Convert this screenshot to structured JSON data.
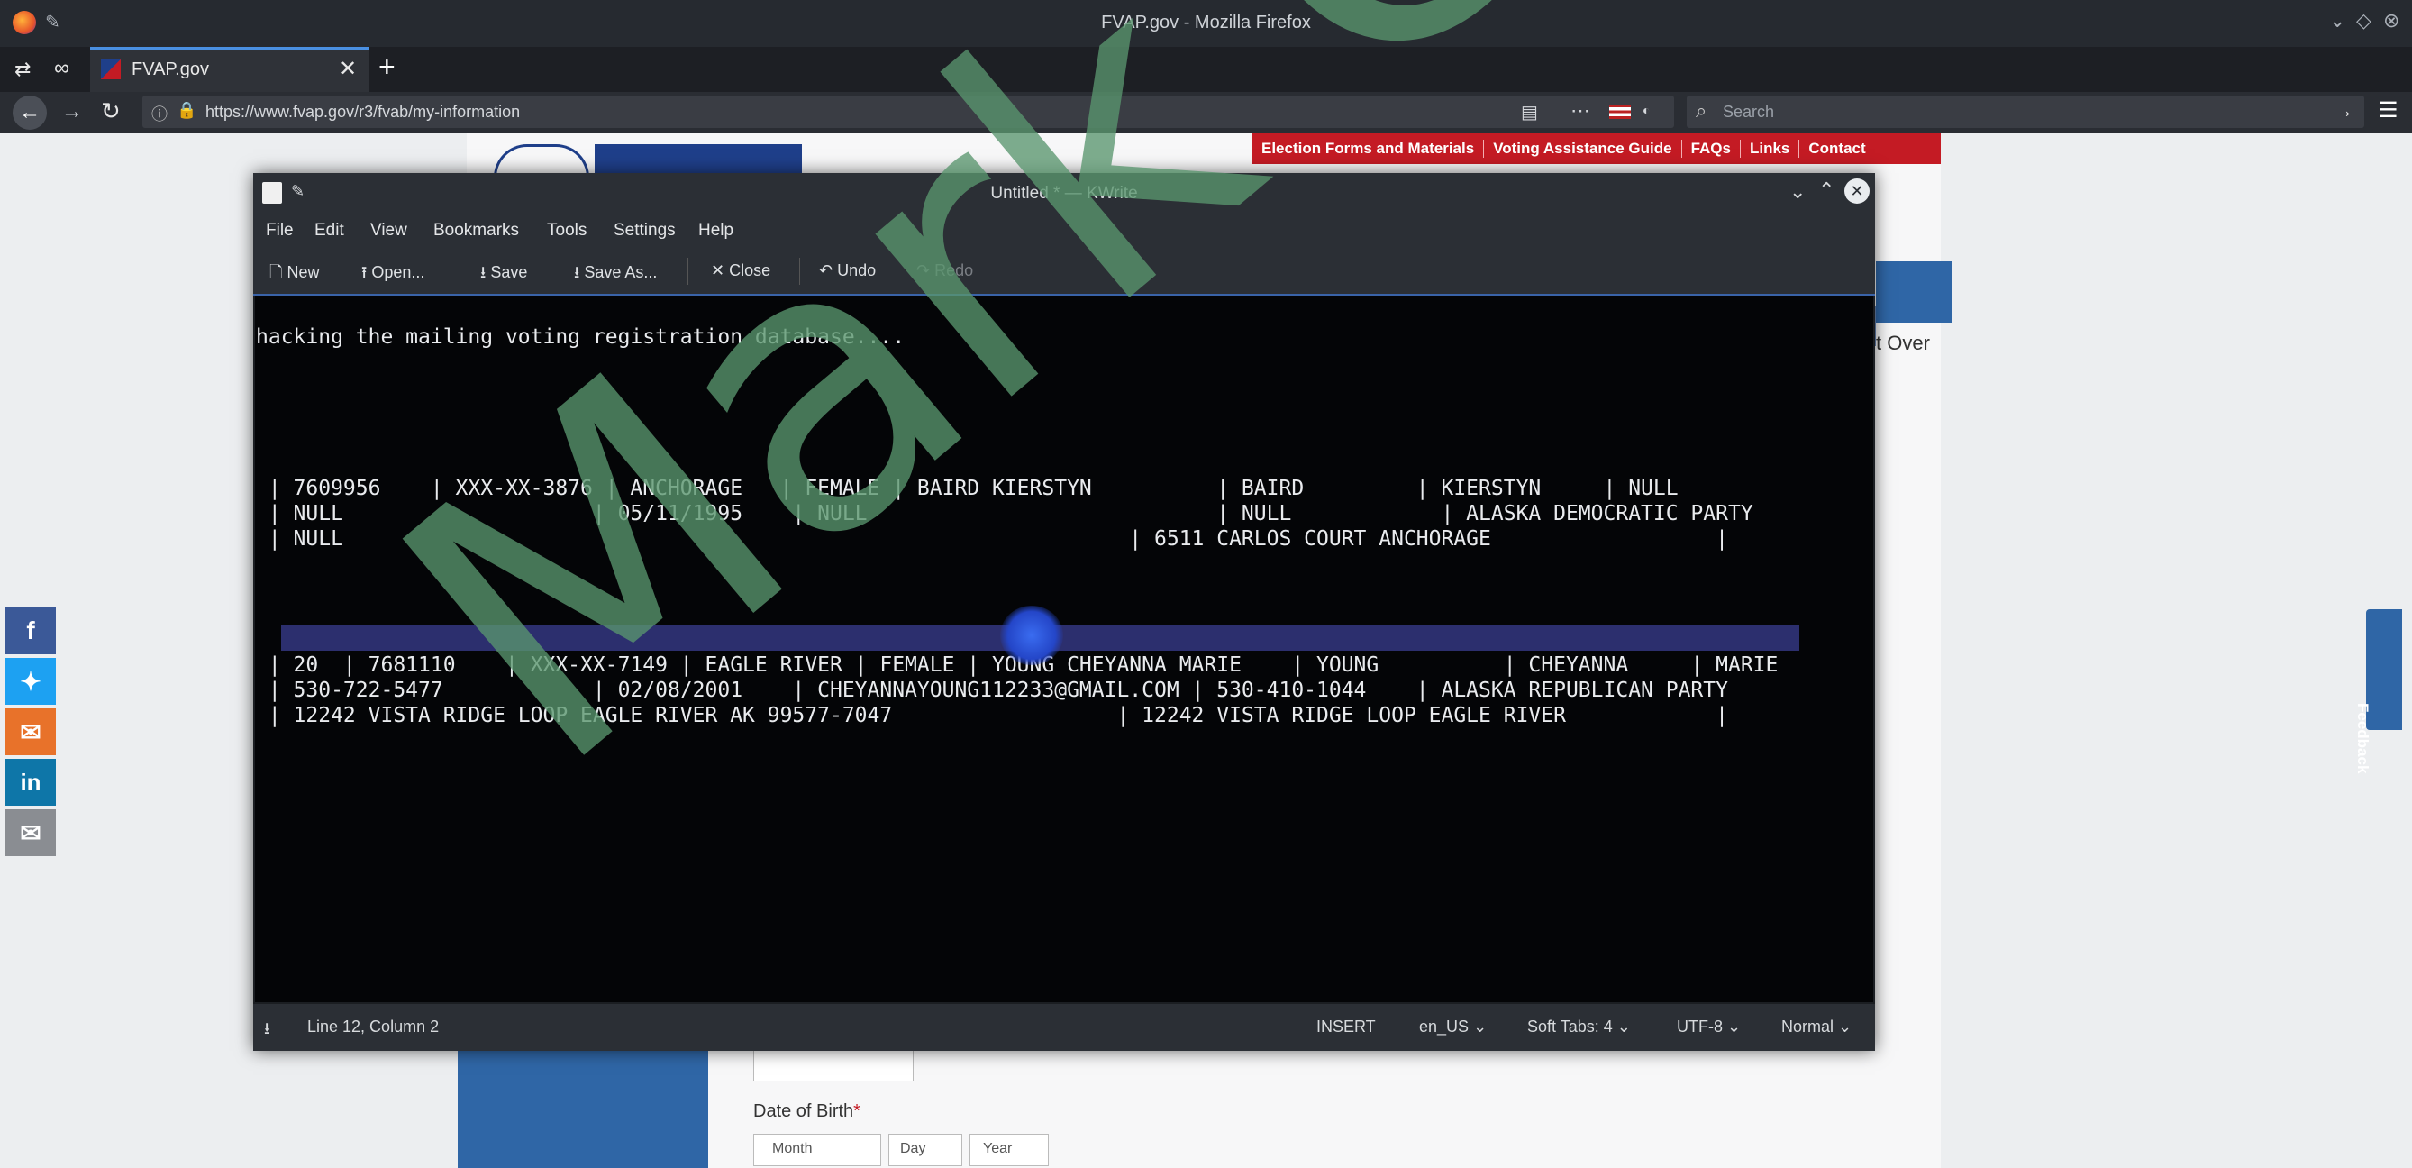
{
  "browser": {
    "window_title": "FVAP.gov - Mozilla Firefox",
    "tab_title": "FVAP.gov",
    "url": "https://www.fvap.gov/r3/fvab/my-information",
    "search_placeholder": "Search",
    "new_tab_symbol": "+"
  },
  "site": {
    "nav": [
      "Election Forms and Materials",
      "Voting Assistance Guide",
      "FAQs",
      "Links",
      "Contact"
    ],
    "start_over": "t Over",
    "feedback": "Feedback",
    "dob_label": "Date of Birth",
    "dob_required": "*",
    "dob_selects": [
      "Month",
      "Day",
      "Year"
    ]
  },
  "kwrite": {
    "title": "Untitled * — KWrite",
    "menu": [
      "File",
      "Edit",
      "View",
      "Bookmarks",
      "Tools",
      "Settings",
      "Help"
    ],
    "toolbar": [
      "New",
      "Open...",
      "Save",
      "Save As...",
      "Close",
      "Undo",
      "Redo"
    ],
    "editor_lines": [
      "hacking the mailing voting registration database....",
      "",
      "",
      "",
      "",
      "",
      " | 7609956    | XXX-XX-3876 | ANCHORAGE   | FEMALE | BAIRD KIERSTYN          | BAIRD         | KIERSTYN     | NULL",
      " | NULL                    | 05/11/1995    | NULL                            | NULL            | ALASKA DEMOCRATIC PARTY",
      " | NULL                                                               | 6511 CARLOS COURT ANCHORAGE                  |",
      "",
      "",
      "",
      "",
      " | 20  | 7681110    | XXX-XX-7149 | EAGLE RIVER | FEMALE | YOUNG CHEYANNA MARIE    | YOUNG          | CHEYANNA     | MARIE",
      " | 530-722-5477            | 02/08/2001    | CHEYANNAYOUNG112233@GMAIL.COM | 530-410-1044    | ALASKA REPUBLICAN PARTY",
      " | 12242 VISTA RIDGE LOOP EAGLE RIVER AK 99577-7047                  | 12242 VISTA RIDGE LOOP EAGLE RIVER            |"
    ],
    "status": {
      "position": "Line 12, Column 2",
      "mode": "INSERT",
      "language": "en_US",
      "tabs": "Soft Tabs: 4",
      "encoding": "UTF-8",
      "syntax": "Normal"
    }
  },
  "watermark": "Mark Cook"
}
